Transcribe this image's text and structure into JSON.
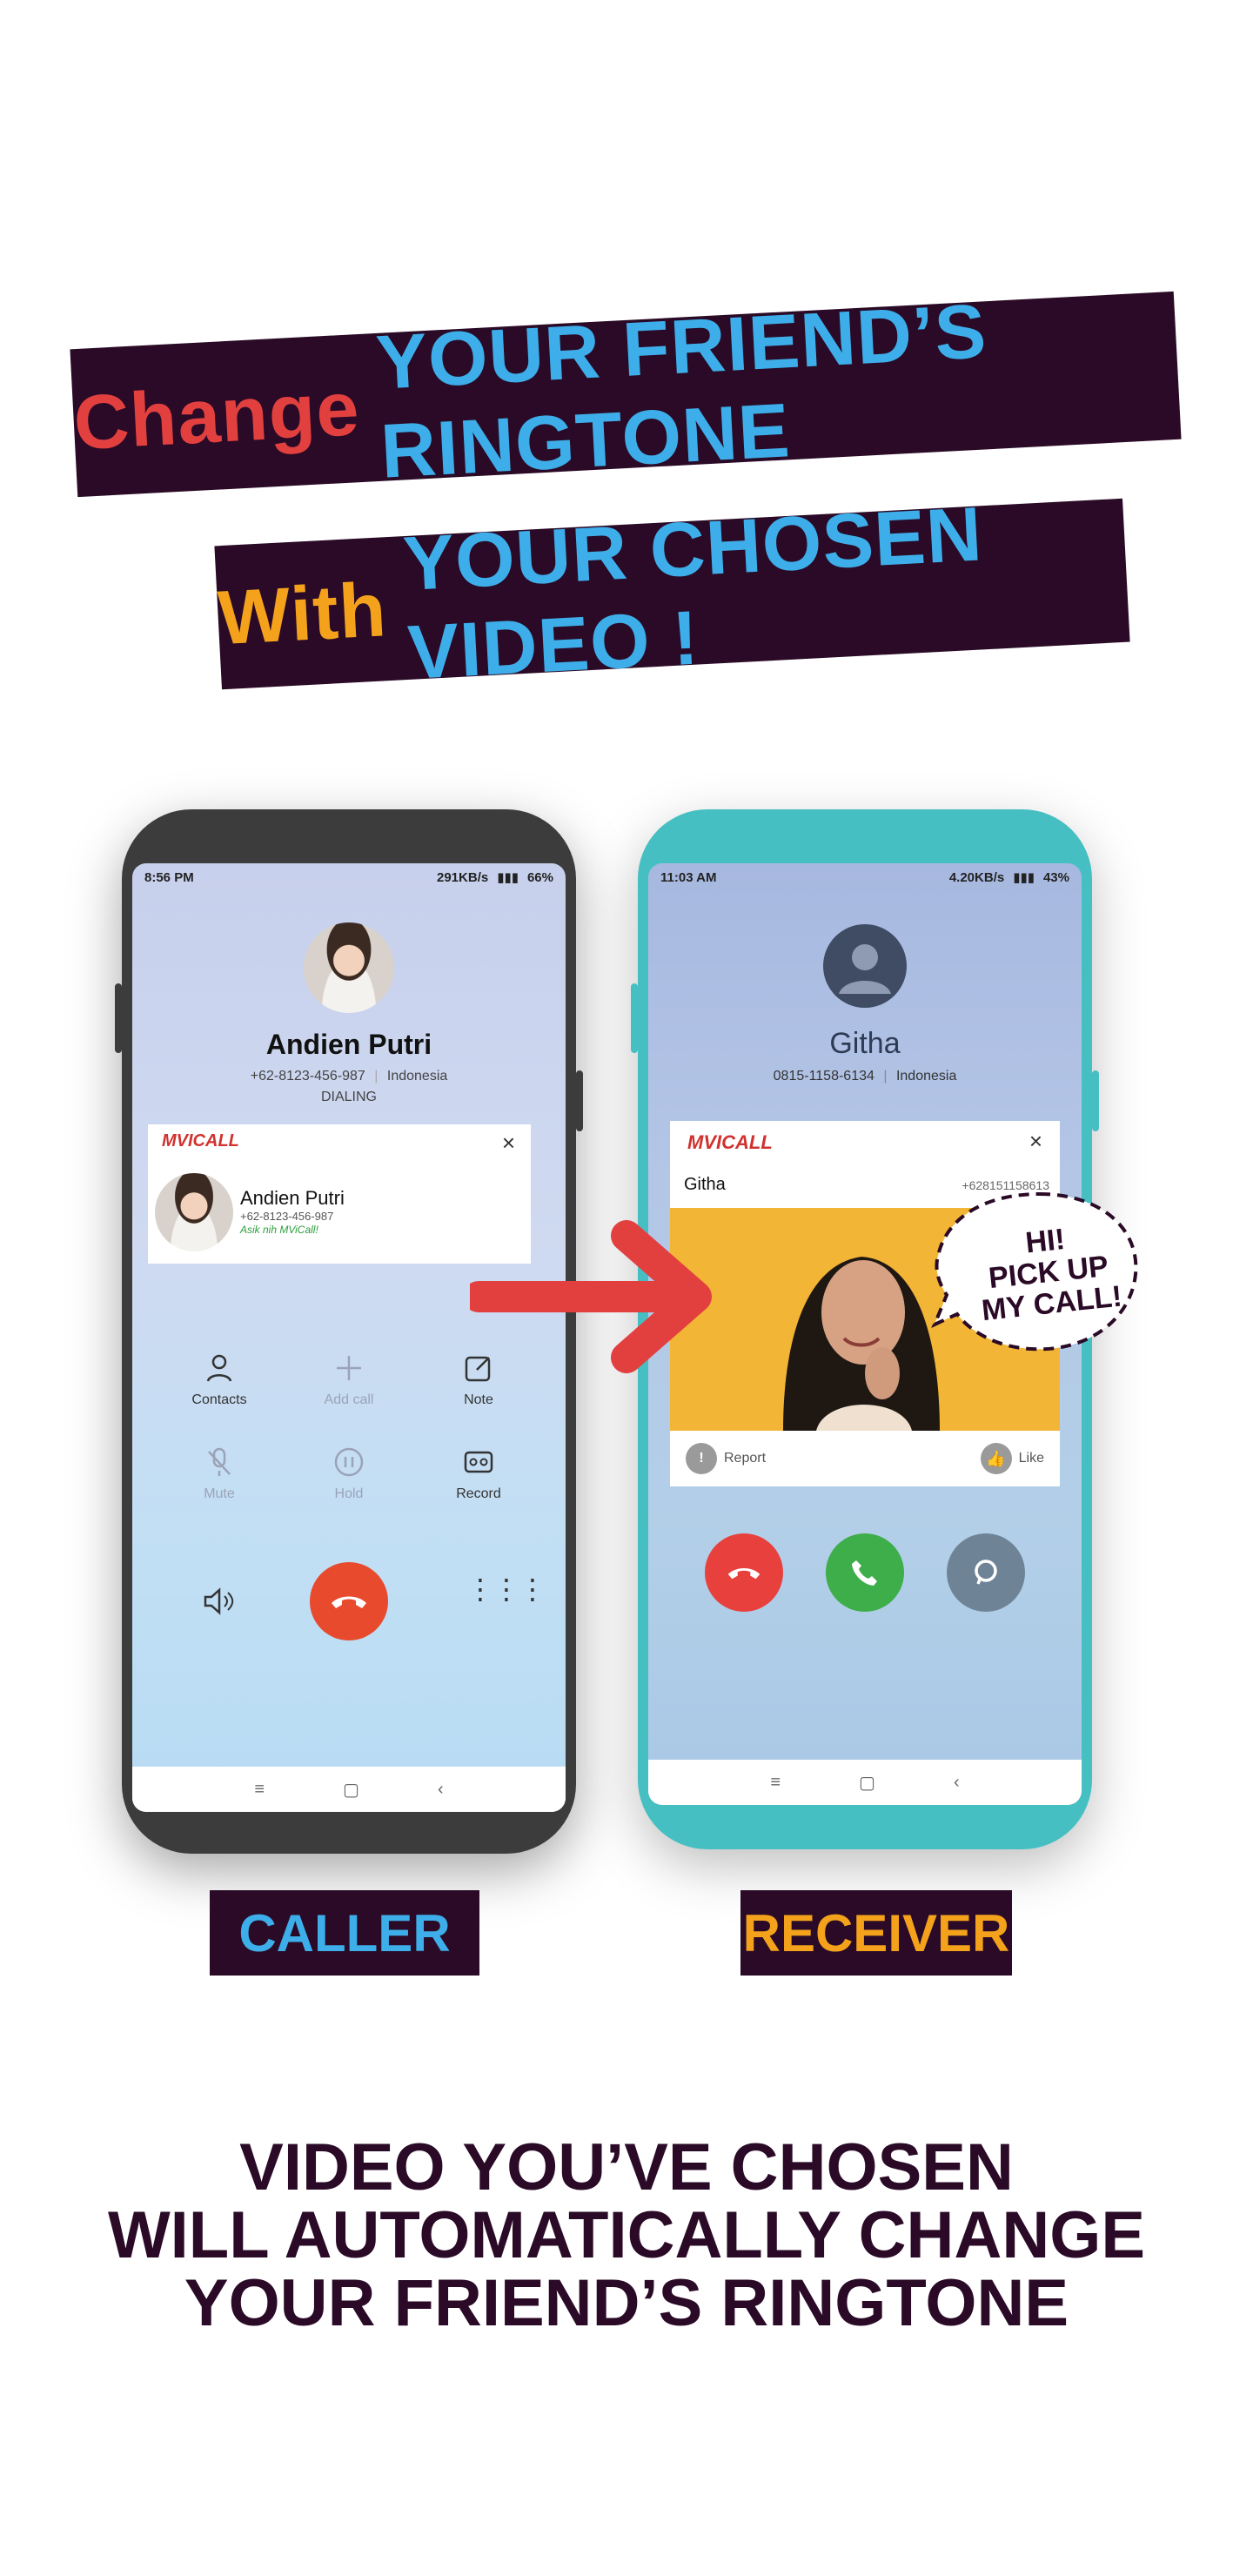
{
  "headline": {
    "line1": {
      "word1": "Change",
      "rest": "YOUR FRIEND’S RINGTONE"
    },
    "line2": {
      "word1": "With",
      "rest": "YOUR CHOSEN VIDEO !"
    }
  },
  "caller_phone": {
    "status_time": "8:56 PM",
    "status_right": "291KB/s",
    "battery": "66%",
    "contact_name": "Andien Putri",
    "contact_number": "+62-8123-456-987",
    "contact_country": "Indonesia",
    "call_state": "DIALING",
    "card": {
      "logo": "MVICALL",
      "name": "Andien Putri",
      "number": "+62-8123-456-987",
      "tagline": "Asik nih MViCall!"
    },
    "controls": [
      "Contacts",
      "Add call",
      "Note",
      "Mute",
      "Hold",
      "Record"
    ]
  },
  "receiver_phone": {
    "status_time": "11:03 AM",
    "status_right": "4.20KB/s",
    "battery": "43%",
    "contact_name": "Githa",
    "contact_number": "0815-1158-6134",
    "contact_country": "Indonesia",
    "card": {
      "logo": "MVICALL",
      "name": "Githa",
      "number": "+628151158613",
      "report": "Report",
      "like": "Like"
    }
  },
  "speech_bubble": {
    "line1": "HI!",
    "line2": "PICK UP",
    "line3": "MY CALL!"
  },
  "labels": {
    "caller": "CALLER",
    "receiver": "RECEIVER"
  },
  "footer": {
    "line1": "VIDEO YOU’VE CHOSEN",
    "line2": "WILL AUTOMATICALLY CHANGE",
    "line3": "YOUR FRIEND’S RINGTONE"
  },
  "colors": {
    "dark": "#2a0a26",
    "red": "#e2403f",
    "orange": "#f4a21b",
    "blue": "#3daee9",
    "teal": "#45bfc2"
  }
}
